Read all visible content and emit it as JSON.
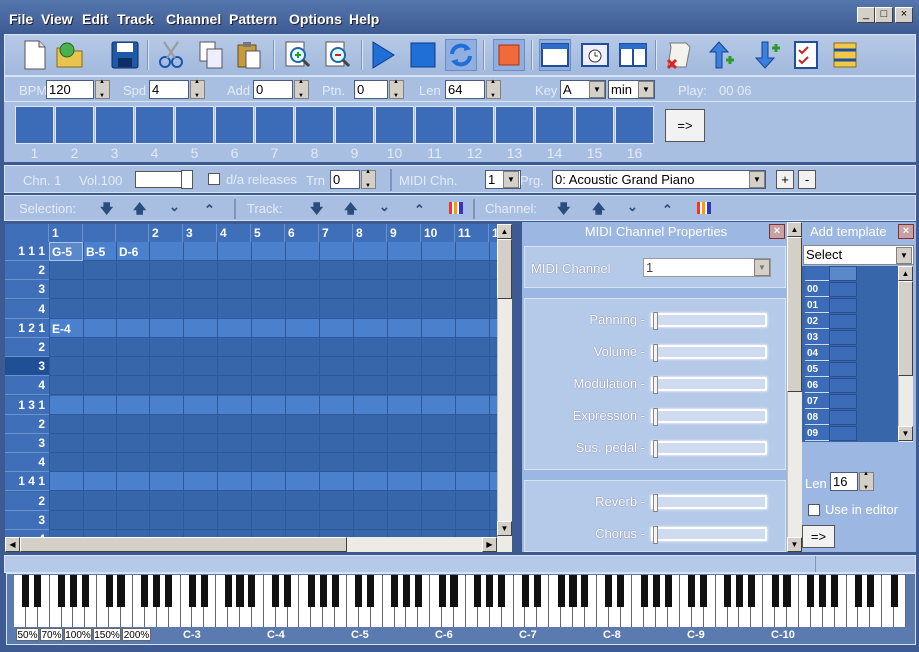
{
  "menu": [
    "File",
    "View",
    "Edit",
    "Track",
    "Channel",
    "Pattern",
    "Options",
    "Help"
  ],
  "window_controls": [
    "_",
    "□",
    "×"
  ],
  "toolbar_icons": [
    "new-icon",
    "open-icon",
    "save-icon",
    "cut-icon",
    "copy-icon",
    "paste-icon",
    "zoom-in-icon",
    "zoom-out-icon",
    "play-icon",
    "stop-icon",
    "loop-icon",
    "record-icon",
    "window-icon",
    "clock-icon",
    "split-icon",
    "scroll-icon",
    "insert-up-icon",
    "insert-down-icon",
    "checklist-icon",
    "bars-icon"
  ],
  "params": {
    "bpm_label": "BPM",
    "bpm": "120",
    "spd_label": "Spd",
    "spd": "4",
    "add_label": "Add",
    "add": "0",
    "ptn_label": "Ptn.",
    "ptn": "0",
    "len_label": "Len",
    "len": "64",
    "key_label": "Key",
    "key": "A",
    "mode": "min",
    "play_label": "Play:",
    "play_time": "00 06"
  },
  "pattern_slots": [
    "1",
    "2",
    "3",
    "4",
    "5",
    "6",
    "7",
    "8",
    "9",
    "10",
    "11",
    "12",
    "13",
    "14",
    "15",
    "16"
  ],
  "pattern_arrow": "=>",
  "channel": {
    "chn_label": "Chn. 1",
    "vol_label": "Vol.100",
    "da_label": "d/a releases",
    "trn_label": "Trn",
    "trn": "0",
    "midi_chn_label": "MIDI Chn.",
    "midi_chn": "1",
    "prg_label": "Prg.",
    "prg": "0: Acoustic Grand Piano",
    "plus": "+",
    "minus": "-"
  },
  "selbar": {
    "selection_label": "Selection:",
    "track_label": "Track:",
    "channel_label": "Channel:"
  },
  "grid": {
    "columns": [
      "1",
      "",
      "",
      "2",
      "3",
      "4",
      "5",
      "6",
      "7",
      "8",
      "9",
      "10",
      "11",
      "1"
    ],
    "rows": [
      "1 1 1",
      "2",
      "3",
      "4",
      "1 2 1",
      "2",
      "3",
      "4",
      "1 3 1",
      "2",
      "3",
      "4",
      "1 4 1",
      "2",
      "3",
      "4"
    ],
    "notes": [
      {
        "row": 0,
        "col": 0,
        "text": "G-5"
      },
      {
        "row": 0,
        "col": 1,
        "text": "B-5"
      },
      {
        "row": 0,
        "col": 2,
        "text": "D-6"
      },
      {
        "row": 4,
        "col": 0,
        "text": "E-4"
      }
    ]
  },
  "midi_props": {
    "title": "MIDI Channel Properties",
    "midi_channel_label": "MIDI Channel",
    "midi_channel_value": "1",
    "sliders": [
      {
        "label": "Panning  -"
      },
      {
        "label": "Volume  -"
      },
      {
        "label": "Modulation -"
      },
      {
        "label": "Expression -"
      },
      {
        "label": "Sus. pedal  -"
      }
    ],
    "sliders2": [
      {
        "label": "Reverb   -"
      },
      {
        "label": "Chorus   -"
      }
    ]
  },
  "template": {
    "title": "Add template",
    "select": "Select",
    "rows": [
      "00",
      "01",
      "02",
      "03",
      "04",
      "05",
      "06",
      "07",
      "08",
      "09"
    ],
    "len_label": "Len",
    "len": "16",
    "use_label": "Use in editor",
    "arrow": "=>"
  },
  "zoom": [
    "50%",
    "70%",
    "100%",
    "150%",
    "200%"
  ],
  "octaves": [
    "C-3",
    "C-4",
    "C-5",
    "C-6",
    "C-7",
    "C-8",
    "C-9",
    "C-10"
  ]
}
